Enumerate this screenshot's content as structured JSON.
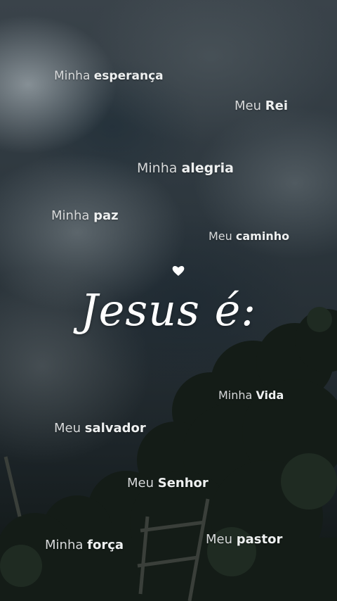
{
  "heading": "Jesus é:",
  "phrases": [
    {
      "prefix": "Minha",
      "word": "esperança"
    },
    {
      "prefix": "Meu",
      "word": "Rei"
    },
    {
      "prefix": "Minha",
      "word": "alegria"
    },
    {
      "prefix": "Minha",
      "word": "paz"
    },
    {
      "prefix": "Meu",
      "word": "caminho"
    },
    {
      "prefix": "Minha",
      "word": "Vida"
    },
    {
      "prefix": "Meu",
      "word": "salvador"
    },
    {
      "prefix": "Meu",
      "word": "Senhor"
    },
    {
      "prefix": "Minha",
      "word": "força"
    },
    {
      "prefix": "Meu",
      "word": "pastor"
    }
  ],
  "icons": {
    "heart": "heart-icon"
  },
  "colors": {
    "text": "#ffffff",
    "sky": "#2a3238"
  }
}
